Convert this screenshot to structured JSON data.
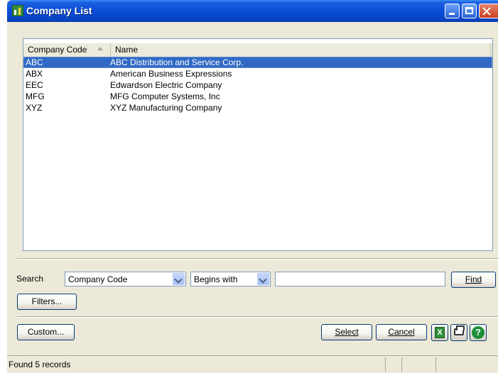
{
  "window": {
    "title": "Company List"
  },
  "list": {
    "columns": {
      "code": "Company Code",
      "name": "Name"
    },
    "rows": [
      {
        "code": "ABC",
        "name": "ABC Distribution and Service Corp."
      },
      {
        "code": "ABX",
        "name": "American Business Expressions"
      },
      {
        "code": "EEC",
        "name": "Edwardson Electric Company"
      },
      {
        "code": "MFG",
        "name": "MFG Computer Systems, Inc"
      },
      {
        "code": "XYZ",
        "name": "XYZ Manufacturing Company"
      }
    ],
    "selected_index": 0
  },
  "search": {
    "label": "Search",
    "field": "Company Code",
    "operator": "Begins with",
    "value": "",
    "find_label": "Find",
    "filters_label": "Filters..."
  },
  "buttons": {
    "custom": "Custom...",
    "select": "Select",
    "cancel": "Cancel"
  },
  "icons": {
    "excel": "excel-icon",
    "print": "printer-icon",
    "help": "help-icon"
  },
  "status": {
    "text": "Found 5 records"
  },
  "colors": {
    "titlebar": "#0a4ed9",
    "selection": "#316ac5",
    "dialog": "#ece9d8"
  }
}
